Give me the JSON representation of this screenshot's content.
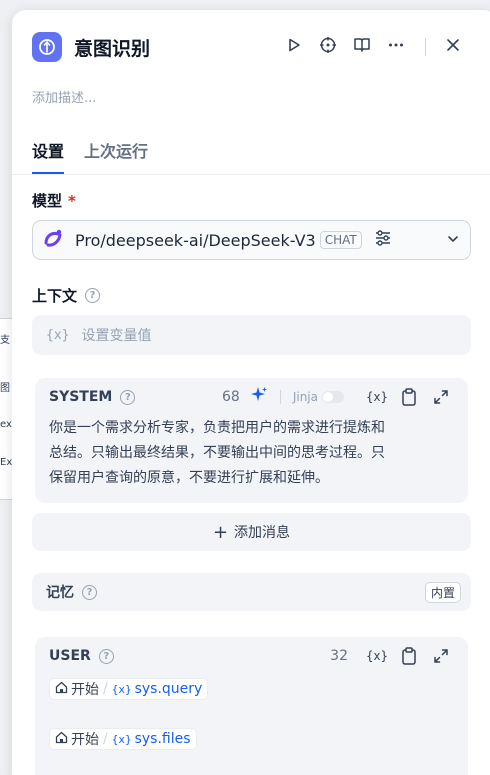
{
  "background": {
    "fragments": [
      "支",
      "图",
      "ex",
      "Ex"
    ]
  },
  "header": {
    "title": "意图识别",
    "description_placeholder": "添加描述..."
  },
  "tabs": [
    {
      "label": "设置",
      "active": true
    },
    {
      "label": "上次运行",
      "active": false
    }
  ],
  "model": {
    "label": "模型",
    "required_mark": "*",
    "name": "Pro/deepseek-ai/DeepSeek-V3",
    "badge": "CHAT"
  },
  "context": {
    "label": "上下文",
    "help": "?",
    "var_icon": "{x}",
    "placeholder": "设置变量值"
  },
  "system": {
    "role": "SYSTEM",
    "help": "?",
    "count": "68",
    "jinja_label": "Jinja",
    "var_icon": "{x}",
    "lines": [
      "你是一个需求分析专家，负责把用户的需求进行提炼和",
      "总结。只输出最终结果，不要输出中间的思考过程。只",
      "保留用户查询的原意，不要进行扩展和延伸。"
    ]
  },
  "add_message": {
    "plus": "+",
    "label": "添加消息"
  },
  "memory": {
    "label": "记忆",
    "help": "?",
    "badge": "内置"
  },
  "user": {
    "role": "USER",
    "help": "?",
    "count": "32",
    "var_icon": "{x}",
    "vars": [
      {
        "node": "开始",
        "sep": "/",
        "icon": "{x}",
        "name": "sys.query"
      },
      {
        "node": "开始",
        "sep": "/",
        "icon": "{x}",
        "name": "sys.files"
      }
    ]
  },
  "colors": {
    "accent": "#155eef",
    "app_icon": "#6172f3",
    "required": "#d92d20",
    "sparkle": "#155eef"
  }
}
